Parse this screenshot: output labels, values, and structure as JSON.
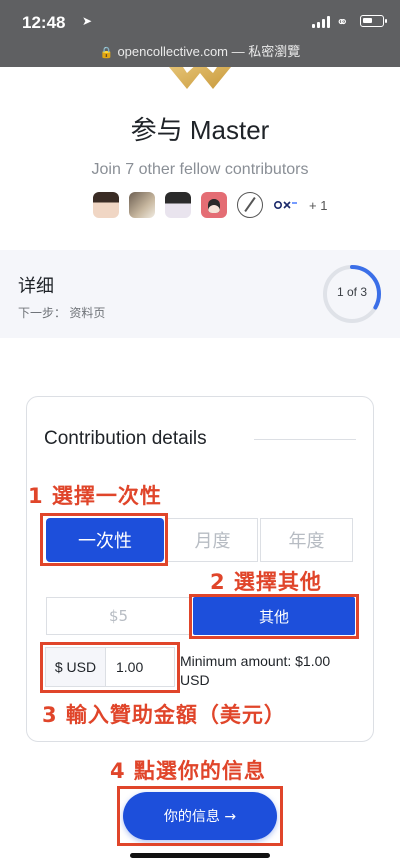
{
  "status_bar": {
    "time": "12:48",
    "location_icon": "location-arrow-icon",
    "url": "opencollective.com — 私密瀏覽"
  },
  "header": {
    "title": "参与 Master",
    "subtitle": "Join 7 other fellow contributors",
    "extra_contributors": "+ 1"
  },
  "steps": {
    "heading": "详细",
    "next_step": "下一步： 资料页",
    "progress_label": "1 of 3",
    "progress_fraction": 0.333
  },
  "contribution": {
    "title": "Contribution details",
    "frequency_options": [
      "一次性",
      "月度",
      "年度"
    ],
    "selected_frequency": "一次性",
    "amount_options": [
      "$5",
      "其他"
    ],
    "selected_amount": "其他",
    "currency": "$ USD",
    "amount_value": "1.00",
    "minimum_note": "Minimum amount: $1.00 USD"
  },
  "annotations": {
    "step1": "1 選擇一次性",
    "step2": "2 選擇其他",
    "step3": "3 輸入贊助金額（美元）",
    "step4": "4 點選你的信息"
  },
  "next_button": {
    "label": "你的信息 →"
  },
  "colors": {
    "accent": "#1d4fdb",
    "annotation": "#e0452a",
    "progress": "#3b6fe8"
  }
}
